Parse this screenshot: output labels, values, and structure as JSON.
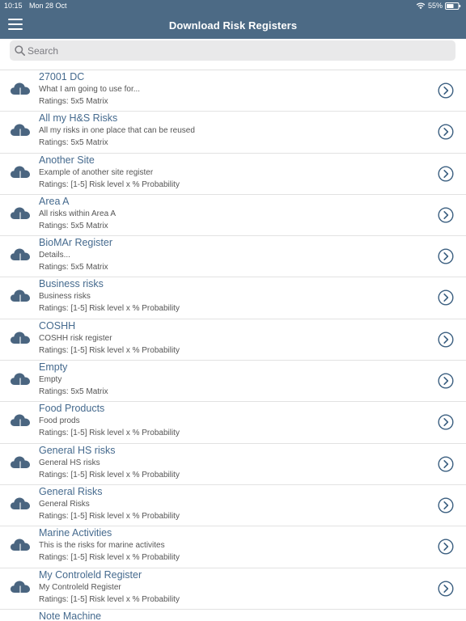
{
  "status": {
    "time": "10:15",
    "date": "Mon 28 Oct",
    "battery": "55%"
  },
  "nav": {
    "title": "Download Risk Registers"
  },
  "search": {
    "placeholder": "Search",
    "value": ""
  },
  "registers": [
    {
      "title": "27001 DC",
      "description": "What I am going to use for...",
      "rating": "Ratings: 5x5 Matrix"
    },
    {
      "title": "All my H&S Risks",
      "description": "All my risks in one place that can be reused",
      "rating": "Ratings: 5x5 Matrix"
    },
    {
      "title": "Another Site",
      "description": "Example of another site register",
      "rating": "Ratings: [1-5] Risk level x % Probability"
    },
    {
      "title": "Area A",
      "description": "All risks within Area A",
      "rating": "Ratings: 5x5 Matrix"
    },
    {
      "title": "BioMAr Register",
      "description": "Details...",
      "rating": "Ratings: 5x5 Matrix"
    },
    {
      "title": "Business risks",
      "description": "Business risks",
      "rating": "Ratings: [1-5] Risk level x % Probability"
    },
    {
      "title": "COSHH",
      "description": "COSHH risk register",
      "rating": "Ratings: [1-5] Risk level x % Probability"
    },
    {
      "title": "Empty",
      "description": "Empty",
      "rating": "Ratings: 5x5 Matrix"
    },
    {
      "title": "Food Products",
      "description": "Food prods",
      "rating": "Ratings: [1-5] Risk level x % Probability"
    },
    {
      "title": "General HS risks",
      "description": "General HS risks",
      "rating": "Ratings: [1-5] Risk level x % Probability"
    },
    {
      "title": "General Risks",
      "description": "General Risks",
      "rating": "Ratings: [1-5] Risk level x % Probability"
    },
    {
      "title": "Marine Activities",
      "description": "This is the risks for marine activites",
      "rating": "Ratings: [1-5] Risk level x % Probability"
    },
    {
      "title": "My Controleld Register",
      "description": "My Controleld Register",
      "rating": "Ratings: [1-5] Risk level x % Probability"
    },
    {
      "title": "Note Machine",
      "description": "",
      "rating": ""
    }
  ],
  "colors": {
    "header_bg": "#4c6a85",
    "title_text": "#456a8e",
    "cloud_icon": "#4a6580",
    "chevron": "#3b5f80"
  },
  "icons": {
    "menu": "hamburger-menu-icon",
    "search": "search-icon",
    "download": "cloud-download-icon",
    "disclosure": "chevron-circle-right-icon"
  }
}
